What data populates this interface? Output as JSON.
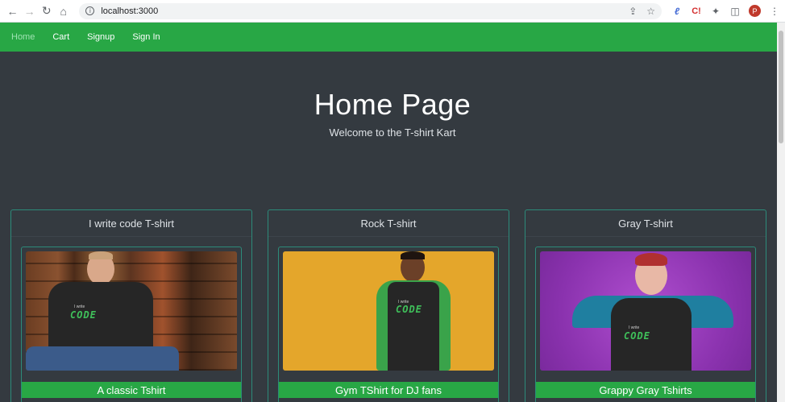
{
  "browser": {
    "url": "localhost:3000",
    "avatar_letter": "P"
  },
  "nav": {
    "items": [
      "Home",
      "Cart",
      "Signup",
      "Sign In"
    ],
    "active": "Home"
  },
  "hero": {
    "title": "Home Page",
    "subtitle": "Welcome to the T-shirt Kart"
  },
  "products": [
    {
      "title": "I write code T-shirt",
      "caption": "A classic Tshirt",
      "image": "man-wood-wall"
    },
    {
      "title": "Rock T-shirt",
      "caption": "Gym TShirt for DJ fans",
      "image": "man-yellow-wall"
    },
    {
      "title": "Gray T-shirt",
      "caption": "Grappy Gray Tshirts",
      "image": "woman-purple-wall"
    }
  ],
  "shirt_print": {
    "line1": "I write",
    "line2": "CODE"
  },
  "colors": {
    "navbar": "#28a745",
    "background": "#343a40",
    "border": "#2c8b7a"
  }
}
